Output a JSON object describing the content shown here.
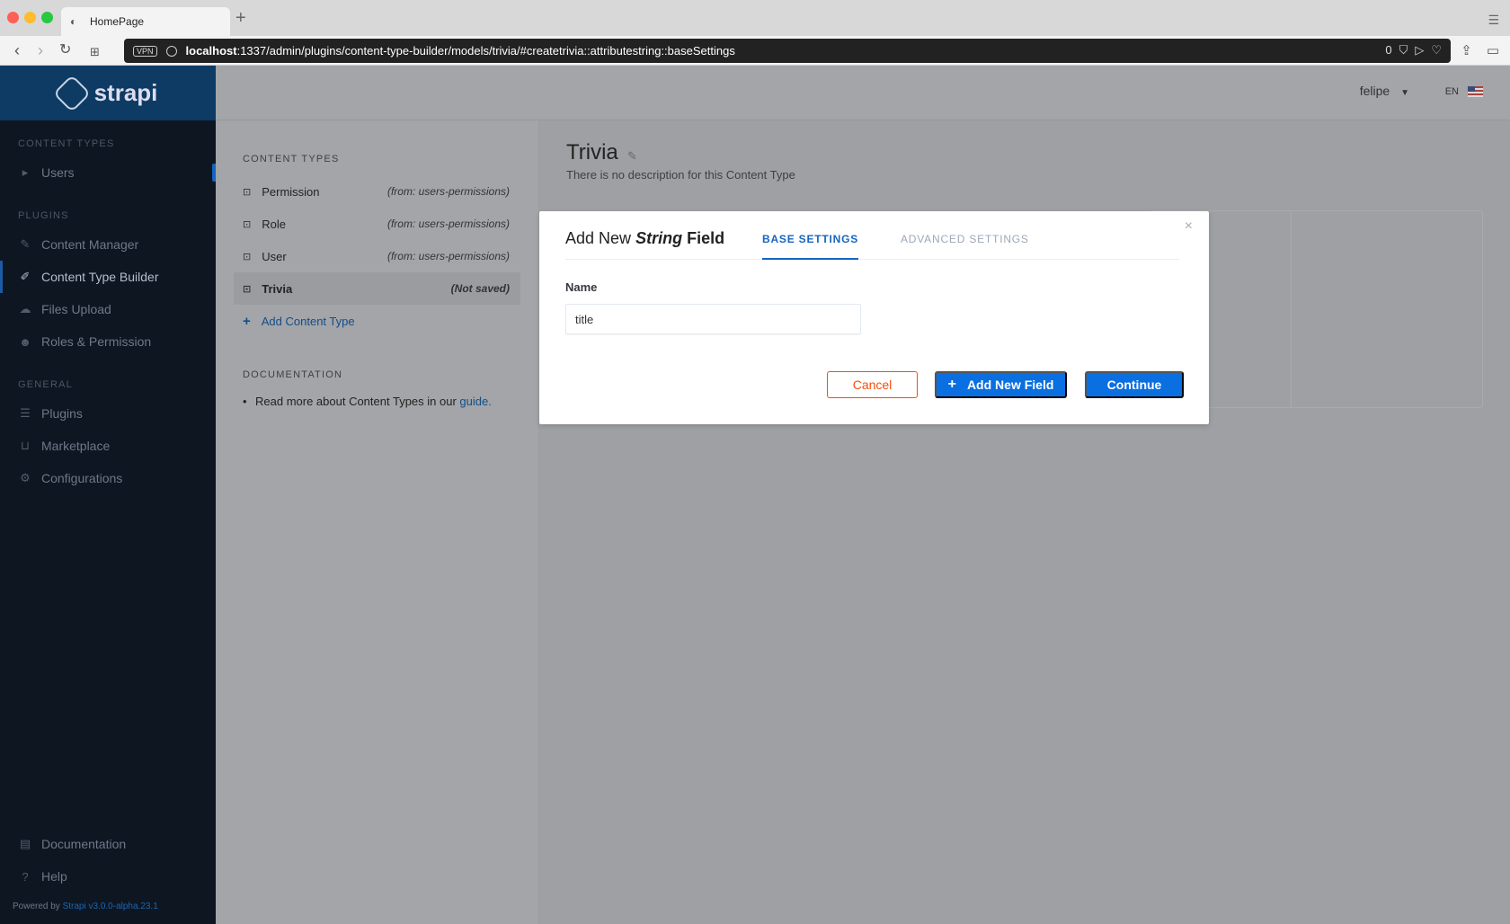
{
  "browser": {
    "tab_title": "HomePage",
    "vpn_label": "VPN",
    "url_host": "localhost",
    "url_rest": ":1337/admin/plugins/content-type-builder/models/trivia/#createtrivia::attributestring::baseSettings",
    "blocked_count": "0"
  },
  "sidebar": {
    "brand": "strapi",
    "content_types_label": "CONTENT TYPES",
    "content_types": [
      {
        "label": "Users"
      }
    ],
    "plugins_label": "PLUGINS",
    "plugins": [
      {
        "label": "Content Manager",
        "icon": "pencil-icon"
      },
      {
        "label": "Content Type Builder",
        "icon": "paint-brush-icon"
      },
      {
        "label": "Files Upload",
        "icon": "cloud-upload-icon"
      },
      {
        "label": "Roles & Permission",
        "icon": "users-icon"
      }
    ],
    "general_label": "GENERAL",
    "general": [
      {
        "label": "Plugins",
        "icon": "list-icon"
      },
      {
        "label": "Marketplace",
        "icon": "basket-icon"
      },
      {
        "label": "Configurations",
        "icon": "gear-icon"
      }
    ],
    "bottom": [
      {
        "label": "Documentation",
        "icon": "book-icon"
      },
      {
        "label": "Help",
        "icon": "question-icon"
      }
    ],
    "powered_by": "Powered by",
    "powered_link": "Strapi v3.0.0-alpha.23.1"
  },
  "topbar": {
    "user": "felipe",
    "lang": "EN"
  },
  "ct_panel": {
    "heading": "CONTENT TYPES",
    "items": [
      {
        "name": "Permission",
        "source": "(from: users-permissions)"
      },
      {
        "name": "Role",
        "source": "(from: users-permissions)"
      },
      {
        "name": "User",
        "source": "(from: users-permissions)"
      },
      {
        "name": "Trivia",
        "source": "(Not saved)"
      }
    ],
    "add_label": "Add Content Type",
    "doc_heading": "DOCUMENTATION",
    "doc_text": "Read more about Content Types in our",
    "doc_link": "guide."
  },
  "main": {
    "title": "Trivia",
    "description": "There is no description for this Content Type"
  },
  "modal": {
    "title_prefix": "Add New",
    "title_type": "String",
    "title_suffix": "Field",
    "tab_base": "BASE SETTINGS",
    "tab_advanced": "ADVANCED SETTINGS",
    "close": "×",
    "name_label": "Name",
    "name_value": "title",
    "cancel": "Cancel",
    "add_new_field": "Add New Field",
    "continue": "Continue"
  }
}
